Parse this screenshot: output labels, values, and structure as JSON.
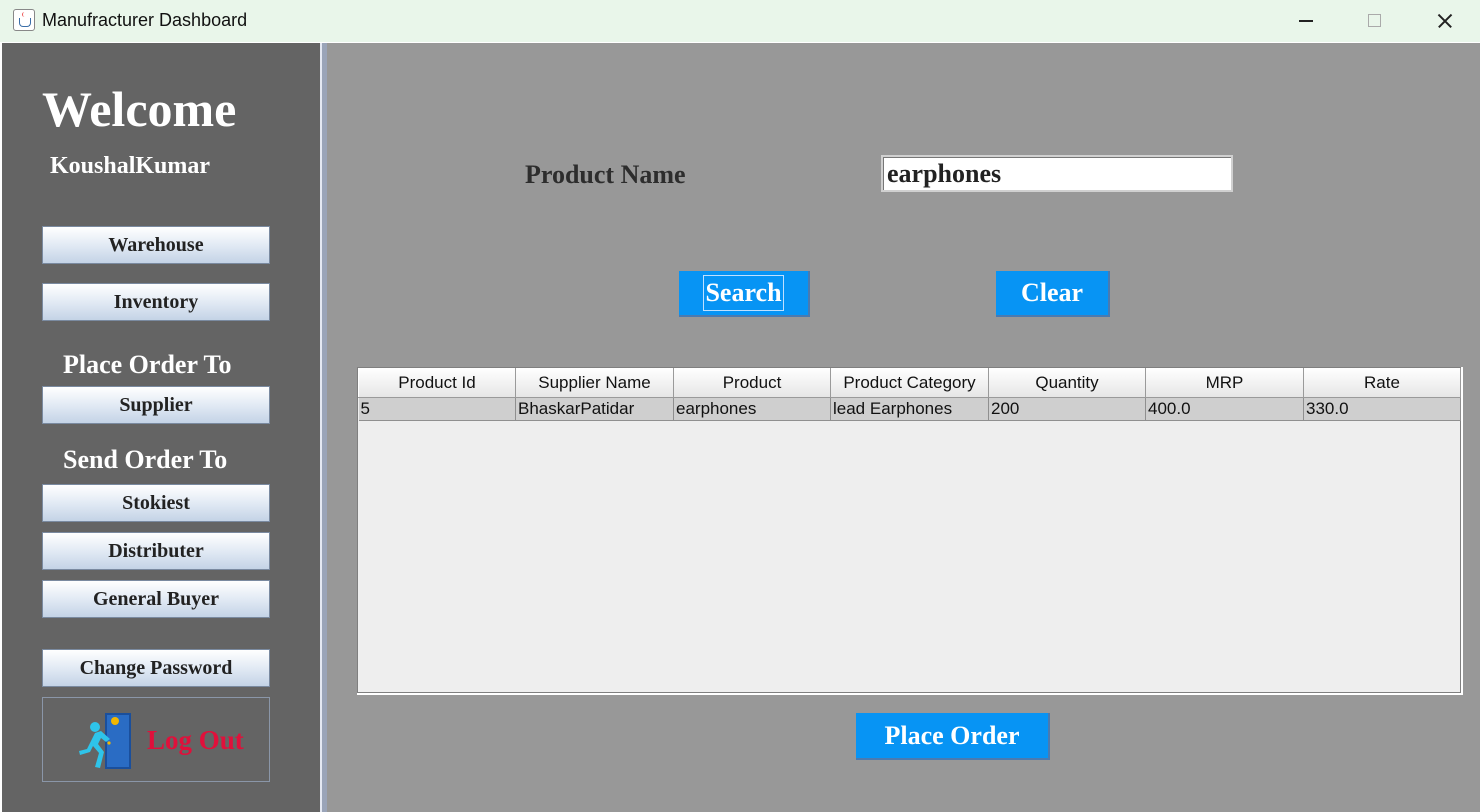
{
  "window": {
    "title": "Manufracturer Dashboard"
  },
  "sidebar": {
    "welcome": "Welcome",
    "username": "KoushalKumar",
    "buttons": {
      "warehouse": "Warehouse",
      "inventory": "Inventory",
      "supplier": "Supplier",
      "stokiest": "Stokiest",
      "distributer": "Distributer",
      "general_buyer": "General Buyer",
      "change_password": "Change Password"
    },
    "place_order_to": "Place Order To",
    "send_order_to": "Send Order To",
    "logout": "Log Out"
  },
  "main": {
    "product_name_label": "Product Name",
    "product_name_value": "earphones",
    "search_label": "Search",
    "clear_label": "Clear",
    "place_order_label": "Place Order",
    "table": {
      "headers": [
        "Product Id",
        "Supplier Name",
        "Product",
        "Product Category",
        "Quantity",
        "MRP",
        "Rate"
      ],
      "rows": [
        [
          "5",
          "BhaskarPatidar",
          "earphones",
          "lead Earphones",
          "200",
          "400.0",
          "330.0"
        ]
      ]
    }
  },
  "colors": {
    "sidebar_bg": "#646464",
    "main_bg": "#989898",
    "accent_button": "#0794f4",
    "logout_text": "#e0103b"
  }
}
